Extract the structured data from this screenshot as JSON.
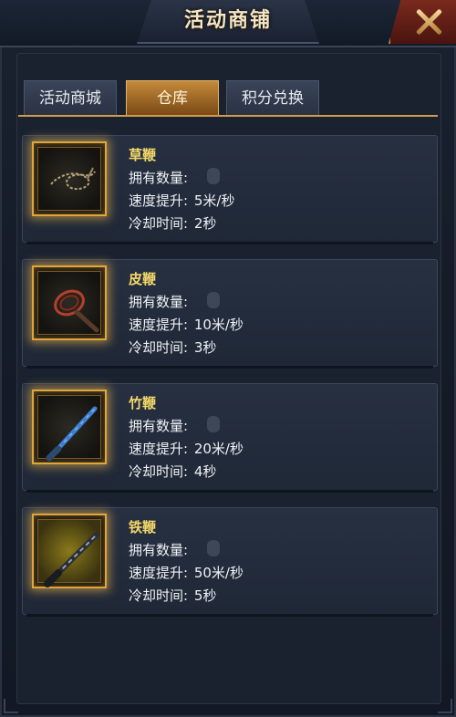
{
  "header": {
    "title": "活动商铺"
  },
  "tabs": [
    {
      "label": "活动商城",
      "active": false
    },
    {
      "label": "仓库",
      "active": true
    },
    {
      "label": "积分兑换",
      "active": false
    }
  ],
  "items": [
    {
      "name": "草鞭",
      "count_label": "拥有数量:",
      "speed_label": "速度提升:",
      "speed_value": "5米/秒",
      "cooldown_label": "冷却时间:",
      "cooldown_value": "2秒",
      "icon": "grass-whip-icon",
      "color": "#9a8660"
    },
    {
      "name": "皮鞭",
      "count_label": "拥有数量:",
      "speed_label": "速度提升:",
      "speed_value": "10米/秒",
      "cooldown_label": "冷却时间:",
      "cooldown_value": "3秒",
      "icon": "leather-whip-icon",
      "color": "#b3402c"
    },
    {
      "name": "竹鞭",
      "count_label": "拥有数量:",
      "speed_label": "速度提升:",
      "speed_value": "20米/秒",
      "cooldown_label": "冷却时间:",
      "cooldown_value": "4秒",
      "icon": "bamboo-whip-icon",
      "color": "#3f7fd0"
    },
    {
      "name": "铁鞭",
      "count_label": "拥有数量:",
      "speed_label": "速度提升:",
      "speed_value": "50米/秒",
      "cooldown_label": "冷却时间:",
      "cooldown_value": "5秒",
      "icon": "iron-whip-icon",
      "color": "#6d7482"
    }
  ],
  "colors": {
    "accent_gold": "#e0a63a",
    "item_name": "#f3d86a",
    "tab_active": "#c48a3a",
    "close_button": "#7a2a1c"
  }
}
